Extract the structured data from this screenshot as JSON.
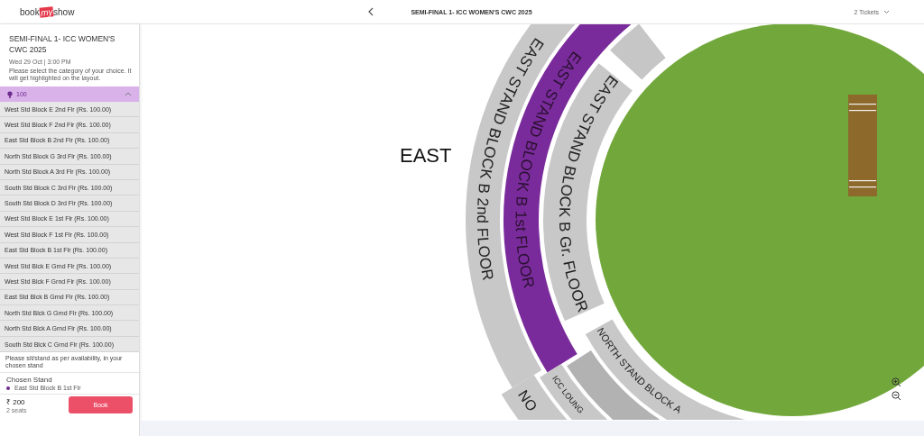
{
  "header": {
    "logo": [
      "book",
      "my",
      "show"
    ],
    "title": "SEMI-FINAL 1- ICC WOMEN'S CWC 2025",
    "tickets": "2 Tickets"
  },
  "event": {
    "title": "SEMI-FINAL 1- ICC WOMEN'S CWC 2025",
    "date": "Wed 29 Oct | 3:00 PM",
    "instructions": "Please select the category of your choice. It will get highlighted on the layout."
  },
  "category": {
    "label": "100",
    "expanded": true,
    "stands": [
      "West Std Block E 2nd Flr (Rs. 100.00)",
      "West Std Block F 2nd Flr (Rs. 100.00)",
      "East Std Block B 2nd Flr (Rs. 100.00)",
      "North Std Block G 3rd Flr (Rs. 100.00)",
      "North Std Block A 3rd Flr (Rs. 100.00)",
      "South Std Block C 3rd Flr (Rs. 100.00)",
      "South Std Block D 3rd Flr (Rs. 100.00)",
      "West Std Block E 1st Flr (Rs. 100.00)",
      "West Std Block F 1st Flr (Rs. 100.00)",
      "East Std Block B 1st Flr (Rs. 100.00)",
      "West Std Blck E Grnd Flr (Rs. 100.00)",
      "West Std Blck F Grnd Flr (Rs. 100.00)",
      "East Std Blck B Grnd Flr (Rs. 100.00)",
      "North Std Blck G Grnd Flr (Rs. 100.00)",
      "North Std Blck A Grnd Flr (Rs. 100.00)",
      "South Std Blck C Grnd Flr (Rs. 100.00)"
    ]
  },
  "note": "Please sit/stand as per availability, in your chosen stand",
  "chosen": {
    "heading": "Chosen Stand",
    "stand": "East Std Block B 1st Flr",
    "color": "#6b2a8c"
  },
  "footer": {
    "price": "₹ 200",
    "seats": "2 seats",
    "button": "Book"
  },
  "map": {
    "side_label": "EAST",
    "stands": [
      {
        "label": "EAST STAND BLOCK B 2nd FLOOR",
        "selected": false
      },
      {
        "label": "EAST STAND BLOCK B 1st FLOOR",
        "selected": true
      },
      {
        "label": "EAST STAND BLOCK B Gr. FLOOR",
        "selected": false
      },
      {
        "label": "NO",
        "selected": false
      },
      {
        "label": "ICC LOUNG",
        "selected": false
      },
      {
        "label": "NORTH STAND BLOCK A",
        "selected": false
      }
    ]
  }
}
